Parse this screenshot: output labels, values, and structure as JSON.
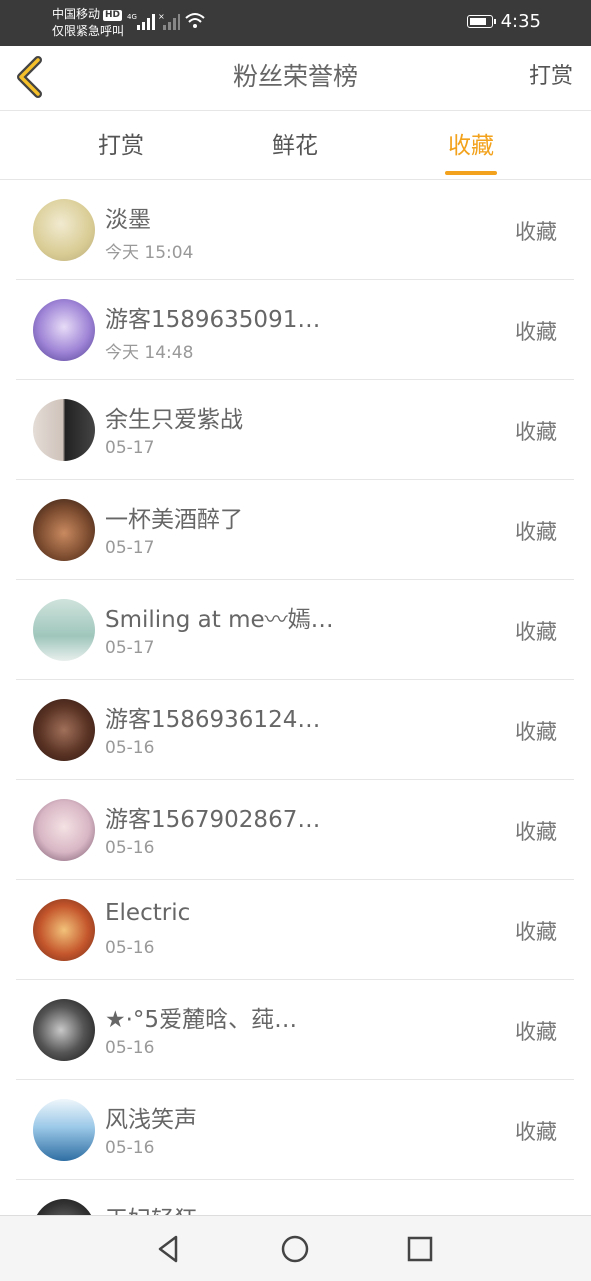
{
  "status_bar": {
    "carrier_line1": "中国移动",
    "hd_badge": "HD",
    "carrier_line2": "仅限紧急呼叫",
    "network": "4G",
    "time": "4:35",
    "battery_level": 0.85
  },
  "header": {
    "back_icon": "chevron-left-icon",
    "title": "粉丝荣誉榜",
    "right_action": "打赏"
  },
  "tabs": [
    {
      "label": "打赏",
      "active": false
    },
    {
      "label": "鲜花",
      "active": false
    },
    {
      "label": "收藏",
      "active": true
    }
  ],
  "list": [
    {
      "name": "淡墨",
      "date": "今天 15:04",
      "action": "收藏"
    },
    {
      "name": "游客1589635091…",
      "date": "今天 14:48",
      "action": "收藏"
    },
    {
      "name": "余生只爱紫战",
      "date": "05-17",
      "action": "收藏"
    },
    {
      "name": "一杯美酒醉了",
      "date": "05-17",
      "action": "收藏"
    },
    {
      "name": "Smiling at me〰嫣…",
      "date": "05-17",
      "action": "收藏"
    },
    {
      "name": "游客1586936124…",
      "date": "05-16",
      "action": "收藏"
    },
    {
      "name": "游客1567902867…",
      "date": "05-16",
      "action": "收藏"
    },
    {
      "name": "Electric",
      "date": "05-16",
      "action": "收藏"
    },
    {
      "name": "★·°5爱麓晗、莼…",
      "date": "05-16",
      "action": "收藏"
    },
    {
      "name": "风浅笑声",
      "date": "05-16",
      "action": "收藏"
    },
    {
      "name": "王妃轻狂",
      "date": "",
      "action": ""
    }
  ],
  "nav_bar": {
    "back": "triangle-back-icon",
    "home": "circle-home-icon",
    "recents": "square-recents-icon"
  },
  "colors": {
    "accent": "#f2a21c",
    "status_bar": "#3a3a3a",
    "text_primary": "#666666",
    "text_secondary": "#999999",
    "divider": "#e6e6e6"
  }
}
